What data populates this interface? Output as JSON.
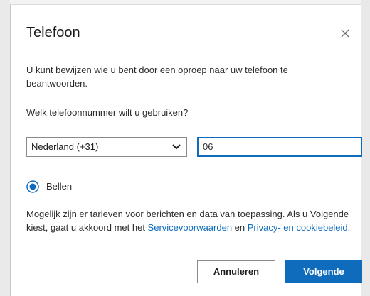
{
  "dialog": {
    "title": "Telefoon",
    "description": "U kunt bewijzen wie u bent door een oproep naar uw telefoon te beantwoorden.",
    "question": "Welk telefoonnummer wilt u gebruiken?",
    "country_select": {
      "selected": "Nederland (+31)"
    },
    "phone_input": {
      "value": "06        "
    },
    "method": {
      "label": "Bellen",
      "selected": true
    },
    "disclaimer": {
      "text_before": "Mogelijk zijn er tarieven voor berichten en data van toepassing. Als u Volgende kiest, gaat u akkoord met het ",
      "terms_link": "Servicevoorwaarden",
      "connector": " en ",
      "privacy_link": "Privacy- en cookiebeleid",
      "text_after": "."
    },
    "buttons": {
      "cancel": "Annuleren",
      "next": "Volgende"
    }
  },
  "icons": {
    "close": "close-icon",
    "chevron": "chevron-down-icon",
    "radio": "radio-selected-icon"
  },
  "colors": {
    "accent": "#0f6cbd"
  }
}
